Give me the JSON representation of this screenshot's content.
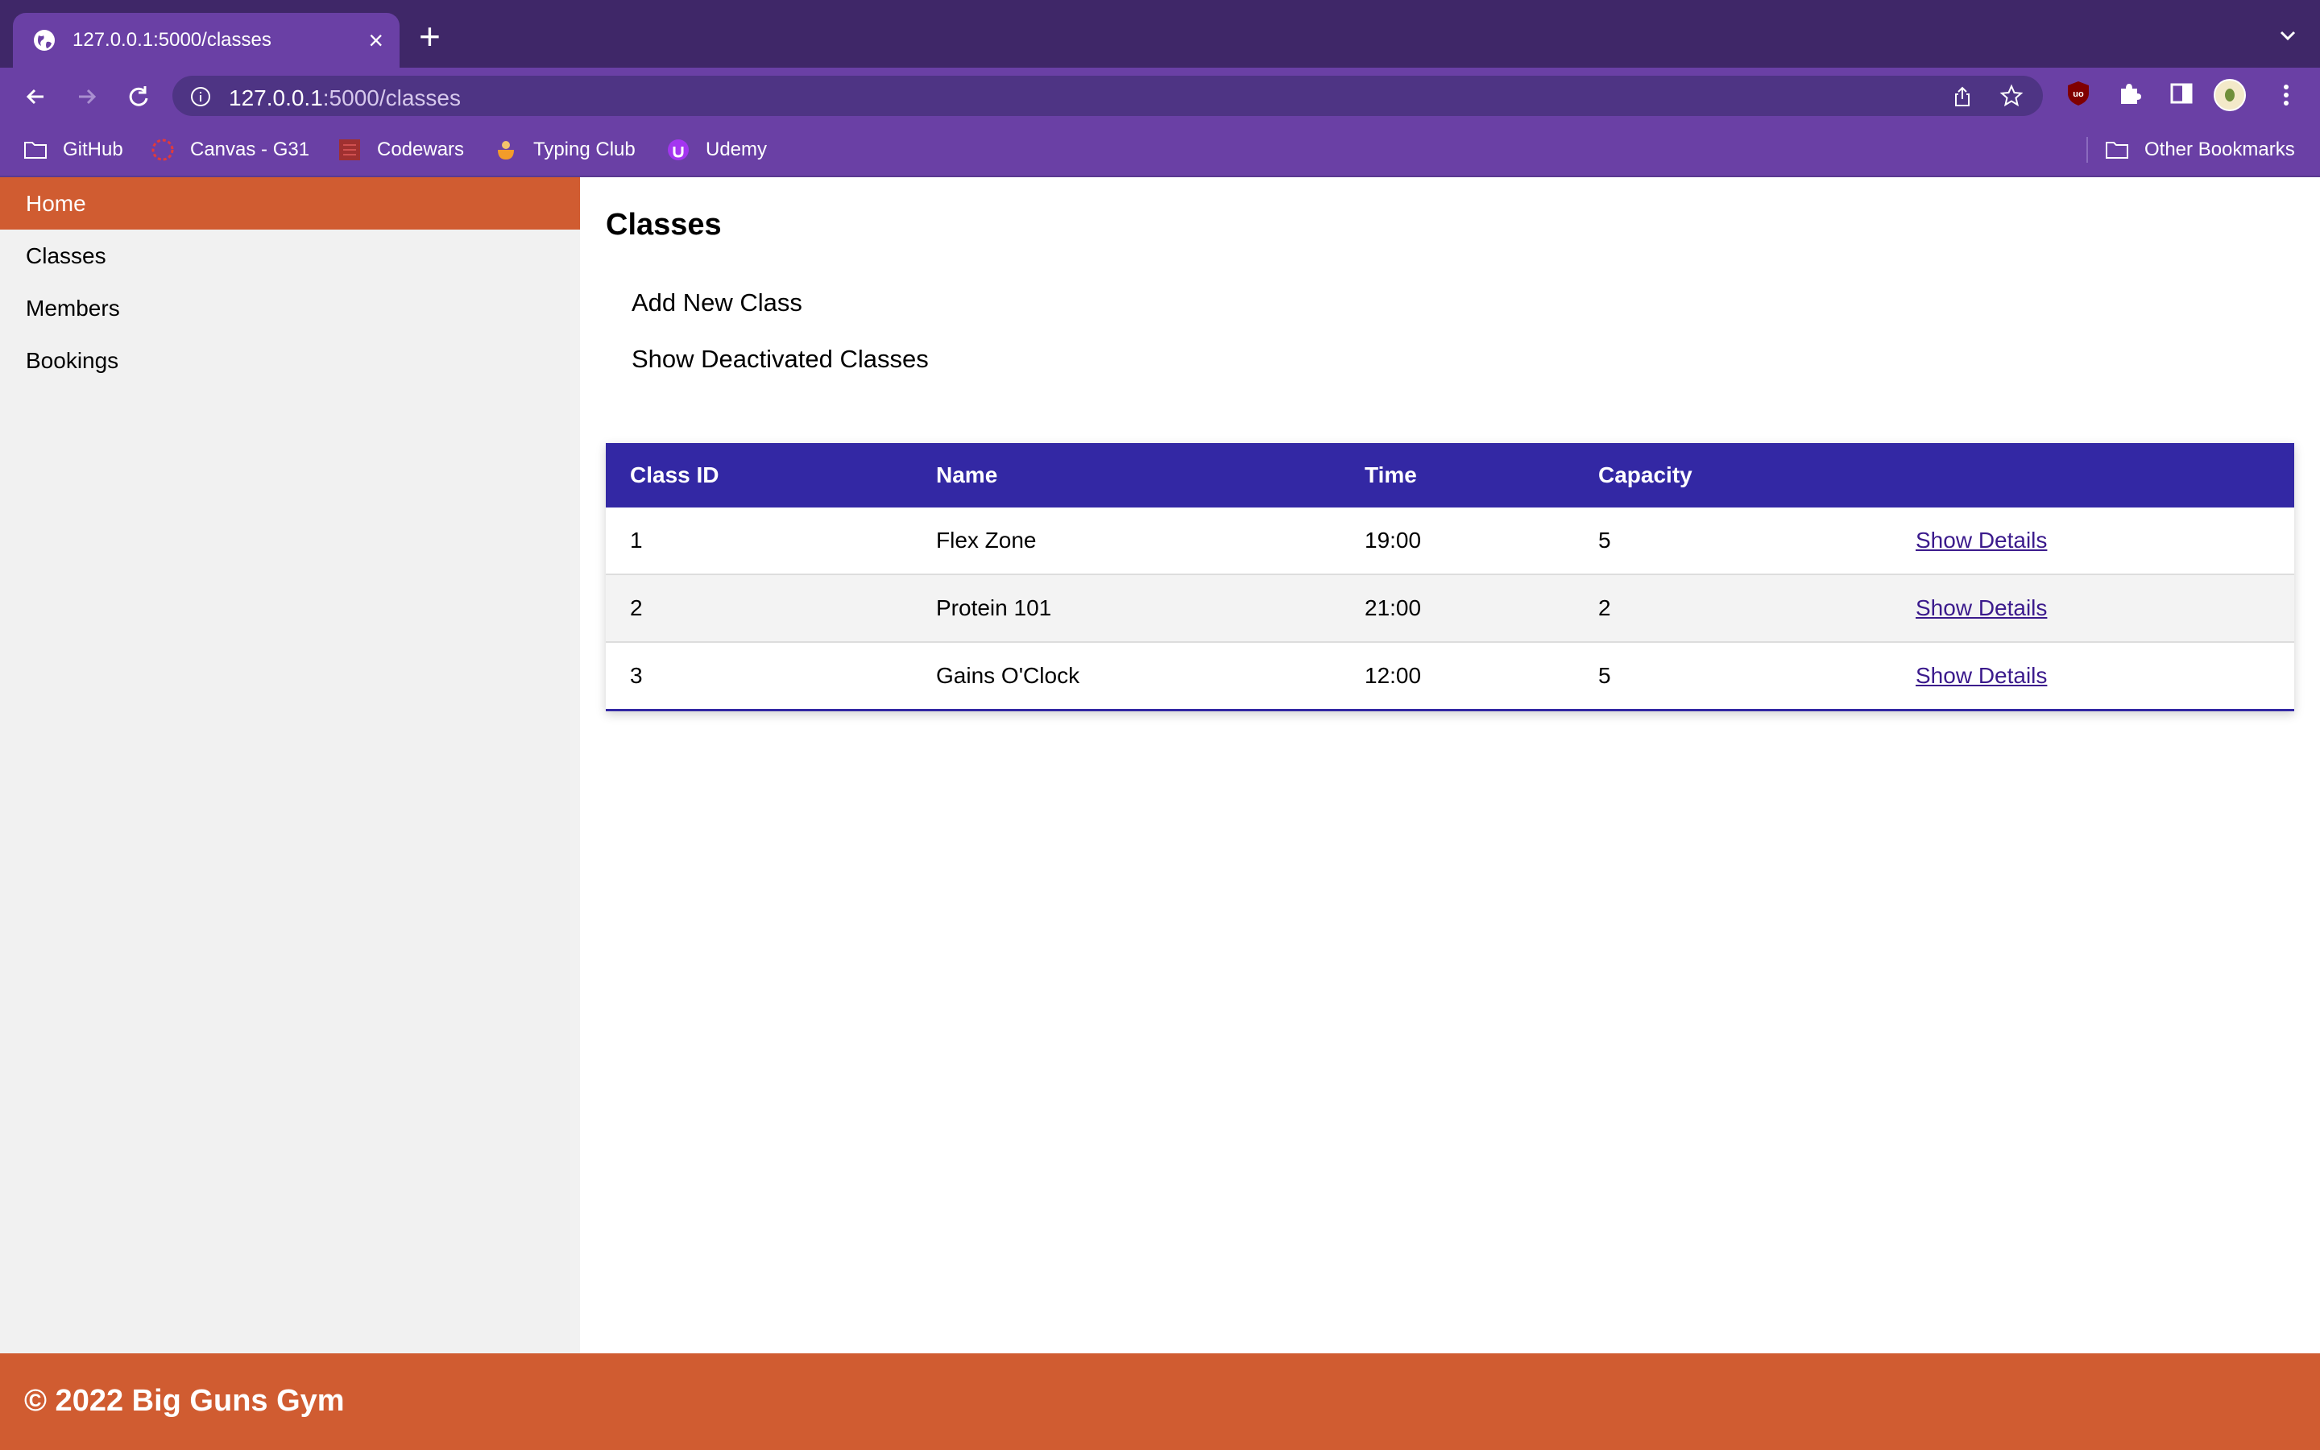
{
  "browser": {
    "tab_title": "127.0.0.1:5000/classes",
    "url_host": "127.0.0.1",
    "url_path": ":5000/classes",
    "bookmarks": [
      {
        "label": "GitHub",
        "icon": "folder-icon"
      },
      {
        "label": "Canvas - G31",
        "icon": "canvas-icon"
      },
      {
        "label": "Codewars",
        "icon": "codewars-icon"
      },
      {
        "label": "Typing Club",
        "icon": "typing-club-icon"
      },
      {
        "label": "Udemy",
        "icon": "udemy-icon"
      }
    ],
    "other_bookmarks": "Other Bookmarks"
  },
  "sidebar": {
    "items": [
      {
        "label": "Home",
        "active": true
      },
      {
        "label": "Classes",
        "active": false
      },
      {
        "label": "Members",
        "active": false
      },
      {
        "label": "Bookings",
        "active": false
      }
    ]
  },
  "main": {
    "title": "Classes",
    "actions": [
      "Add New Class",
      "Show Deactivated Classes"
    ]
  },
  "table": {
    "headers": [
      "Class ID",
      "Name",
      "Time",
      "Capacity",
      ""
    ],
    "rows": [
      {
        "id": "1",
        "name": "Flex Zone",
        "time": "19:00",
        "capacity": "5",
        "link": "Show Details"
      },
      {
        "id": "2",
        "name": "Protein 101",
        "time": "21:00",
        "capacity": "2",
        "link": "Show Details"
      },
      {
        "id": "3",
        "name": "Gains O'Clock",
        "time": "12:00",
        "capacity": "5",
        "link": "Show Details"
      }
    ]
  },
  "footer": {
    "text": "© 2022 Big Guns Gym"
  },
  "colors": {
    "accent_orange": "#d05c31",
    "table_header": "#3328a4",
    "browser_purple": "#6a40a5"
  }
}
